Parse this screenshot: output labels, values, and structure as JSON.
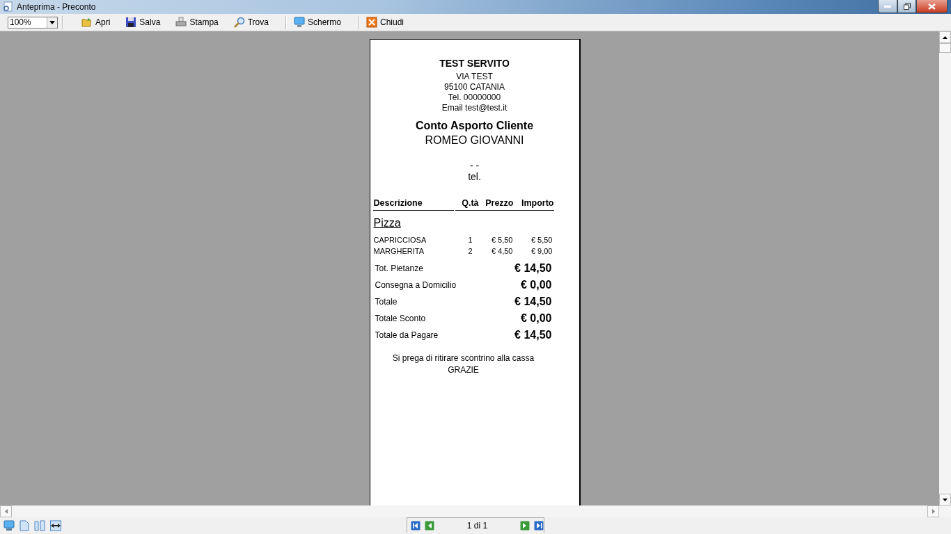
{
  "window": {
    "title": "Anteprima - Preconto"
  },
  "toolbar": {
    "zoom": "100%",
    "buttons": [
      {
        "label": "Apri",
        "kind": "open",
        "separator_before": false
      },
      {
        "label": "Salva",
        "kind": "save",
        "separator_before": false
      },
      {
        "label": "Stampa",
        "kind": "print",
        "separator_before": false
      },
      {
        "label": "Trova",
        "kind": "find",
        "separator_before": false
      },
      {
        "label": "Schermo",
        "kind": "screen",
        "separator_before": true
      },
      {
        "label": "Chiudi",
        "kind": "close",
        "separator_before": true
      }
    ]
  },
  "receipt": {
    "business": "TEST SERVITO",
    "address_lines": [
      "VIA TEST",
      "95100 CATANIA",
      "Tel. 00000000",
      "Email test@test.it"
    ],
    "doc_title": "Conto Asporto Cliente",
    "customer": "ROMEO GIOVANNI",
    "customer_address": "-  -",
    "customer_phone": "tel.",
    "columns": [
      "Descrizione",
      "Q.tà",
      "Prezzo",
      "Importo"
    ],
    "category": "Pizza",
    "items": [
      {
        "description": "CAPRICCIOSA",
        "qty": "1",
        "price": "€ 5,50",
        "amount": "€ 5,50"
      },
      {
        "description": "MARGHERITA",
        "qty": "2",
        "price": "€ 4,50",
        "amount": "€ 9,00"
      }
    ],
    "totals": [
      {
        "label": "Tot. Pietanze",
        "value": "€ 14,50"
      },
      {
        "label": "Consegna a Domicilio",
        "value": "€ 0,00"
      },
      {
        "label": "Totale",
        "value": "€ 14,50"
      },
      {
        "label": "Totale Sconto",
        "value": "€ 0,00"
      },
      {
        "label": "Totale da Pagare",
        "value": "€ 14,50"
      }
    ],
    "footer": [
      "Si prega di ritirare scontrino alla cassa",
      "GRAZIE"
    ]
  },
  "pager": {
    "page": "1 di 1"
  }
}
